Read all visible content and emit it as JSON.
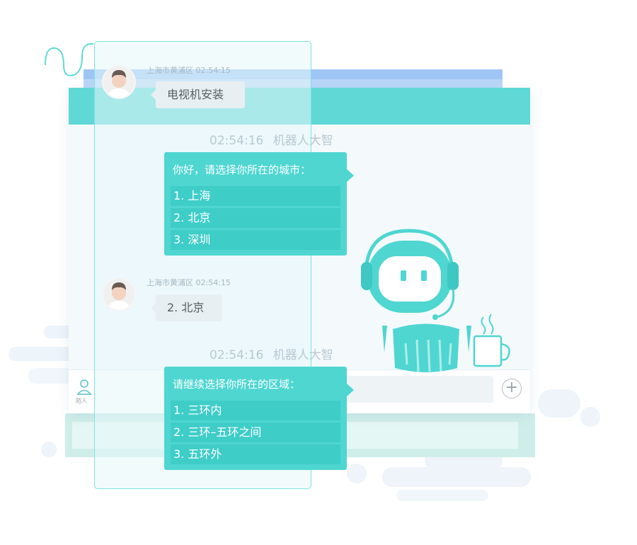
{
  "messages": [
    {
      "type": "user",
      "location": "上海市黄浦区",
      "time": "02:54:15",
      "text": "电视机安装"
    },
    {
      "type": "bot",
      "time": "02:54:16",
      "name": "机器人大智",
      "prompt": "你好，请选择你所在的城市：",
      "options": [
        "1. 上海",
        "2. 北京",
        "3. 深圳"
      ]
    },
    {
      "type": "user",
      "location": "上海市黄浦区",
      "time": "02:54:15",
      "text": "2. 北京"
    },
    {
      "type": "bot",
      "time": "02:54:16",
      "name": "机器人大智",
      "prompt": "请继续选择你所在的区域：",
      "options": [
        "1. 三环内",
        "2. 三环–五环之间",
        "3. 五环外"
      ]
    }
  ],
  "footer": {
    "side_label": "陌人",
    "plus_symbol": "+"
  },
  "icons": {
    "robot": "robot-mascot-icon",
    "mug": "coffee-mug-icon",
    "avatar": "user-avatar-icon",
    "contact": "contact-person-icon",
    "plus": "plus-circle-icon"
  },
  "colors": {
    "primary": "#5fd8d6",
    "bubble": "#4fd6d1",
    "option": "#3fcdc8",
    "panel_border": "#7be3df"
  }
}
